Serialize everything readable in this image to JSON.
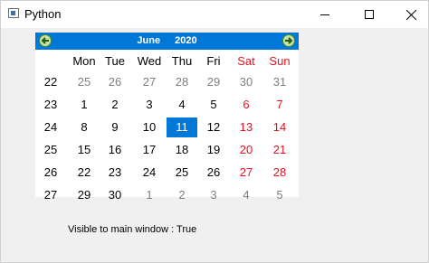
{
  "window": {
    "title": "Python"
  },
  "calendar": {
    "month": "June",
    "year": "2020",
    "day_headers": [
      "Mon",
      "Tue",
      "Wed",
      "Thu",
      "Fri",
      "Sat",
      "Sun"
    ],
    "weeks": [
      {
        "num": "22",
        "days": [
          "25",
          "26",
          "27",
          "28",
          "29",
          "30",
          "31"
        ]
      },
      {
        "num": "23",
        "days": [
          "1",
          "2",
          "3",
          "4",
          "5",
          "6",
          "7"
        ]
      },
      {
        "num": "24",
        "days": [
          "8",
          "9",
          "10",
          "11",
          "12",
          "13",
          "14"
        ]
      },
      {
        "num": "25",
        "days": [
          "15",
          "16",
          "17",
          "18",
          "19",
          "20",
          "21"
        ]
      },
      {
        "num": "26",
        "days": [
          "22",
          "23",
          "24",
          "25",
          "26",
          "27",
          "28"
        ]
      },
      {
        "num": "27",
        "days": [
          "29",
          "30",
          "1",
          "2",
          "3",
          "4",
          "5"
        ]
      }
    ],
    "selected_date": "11",
    "colors": {
      "header": "#0078d7",
      "weekend": "#e81123",
      "other_month": "#7f7f7f",
      "selected": "#0078d7"
    }
  },
  "status_text": "Visible to main window : True"
}
